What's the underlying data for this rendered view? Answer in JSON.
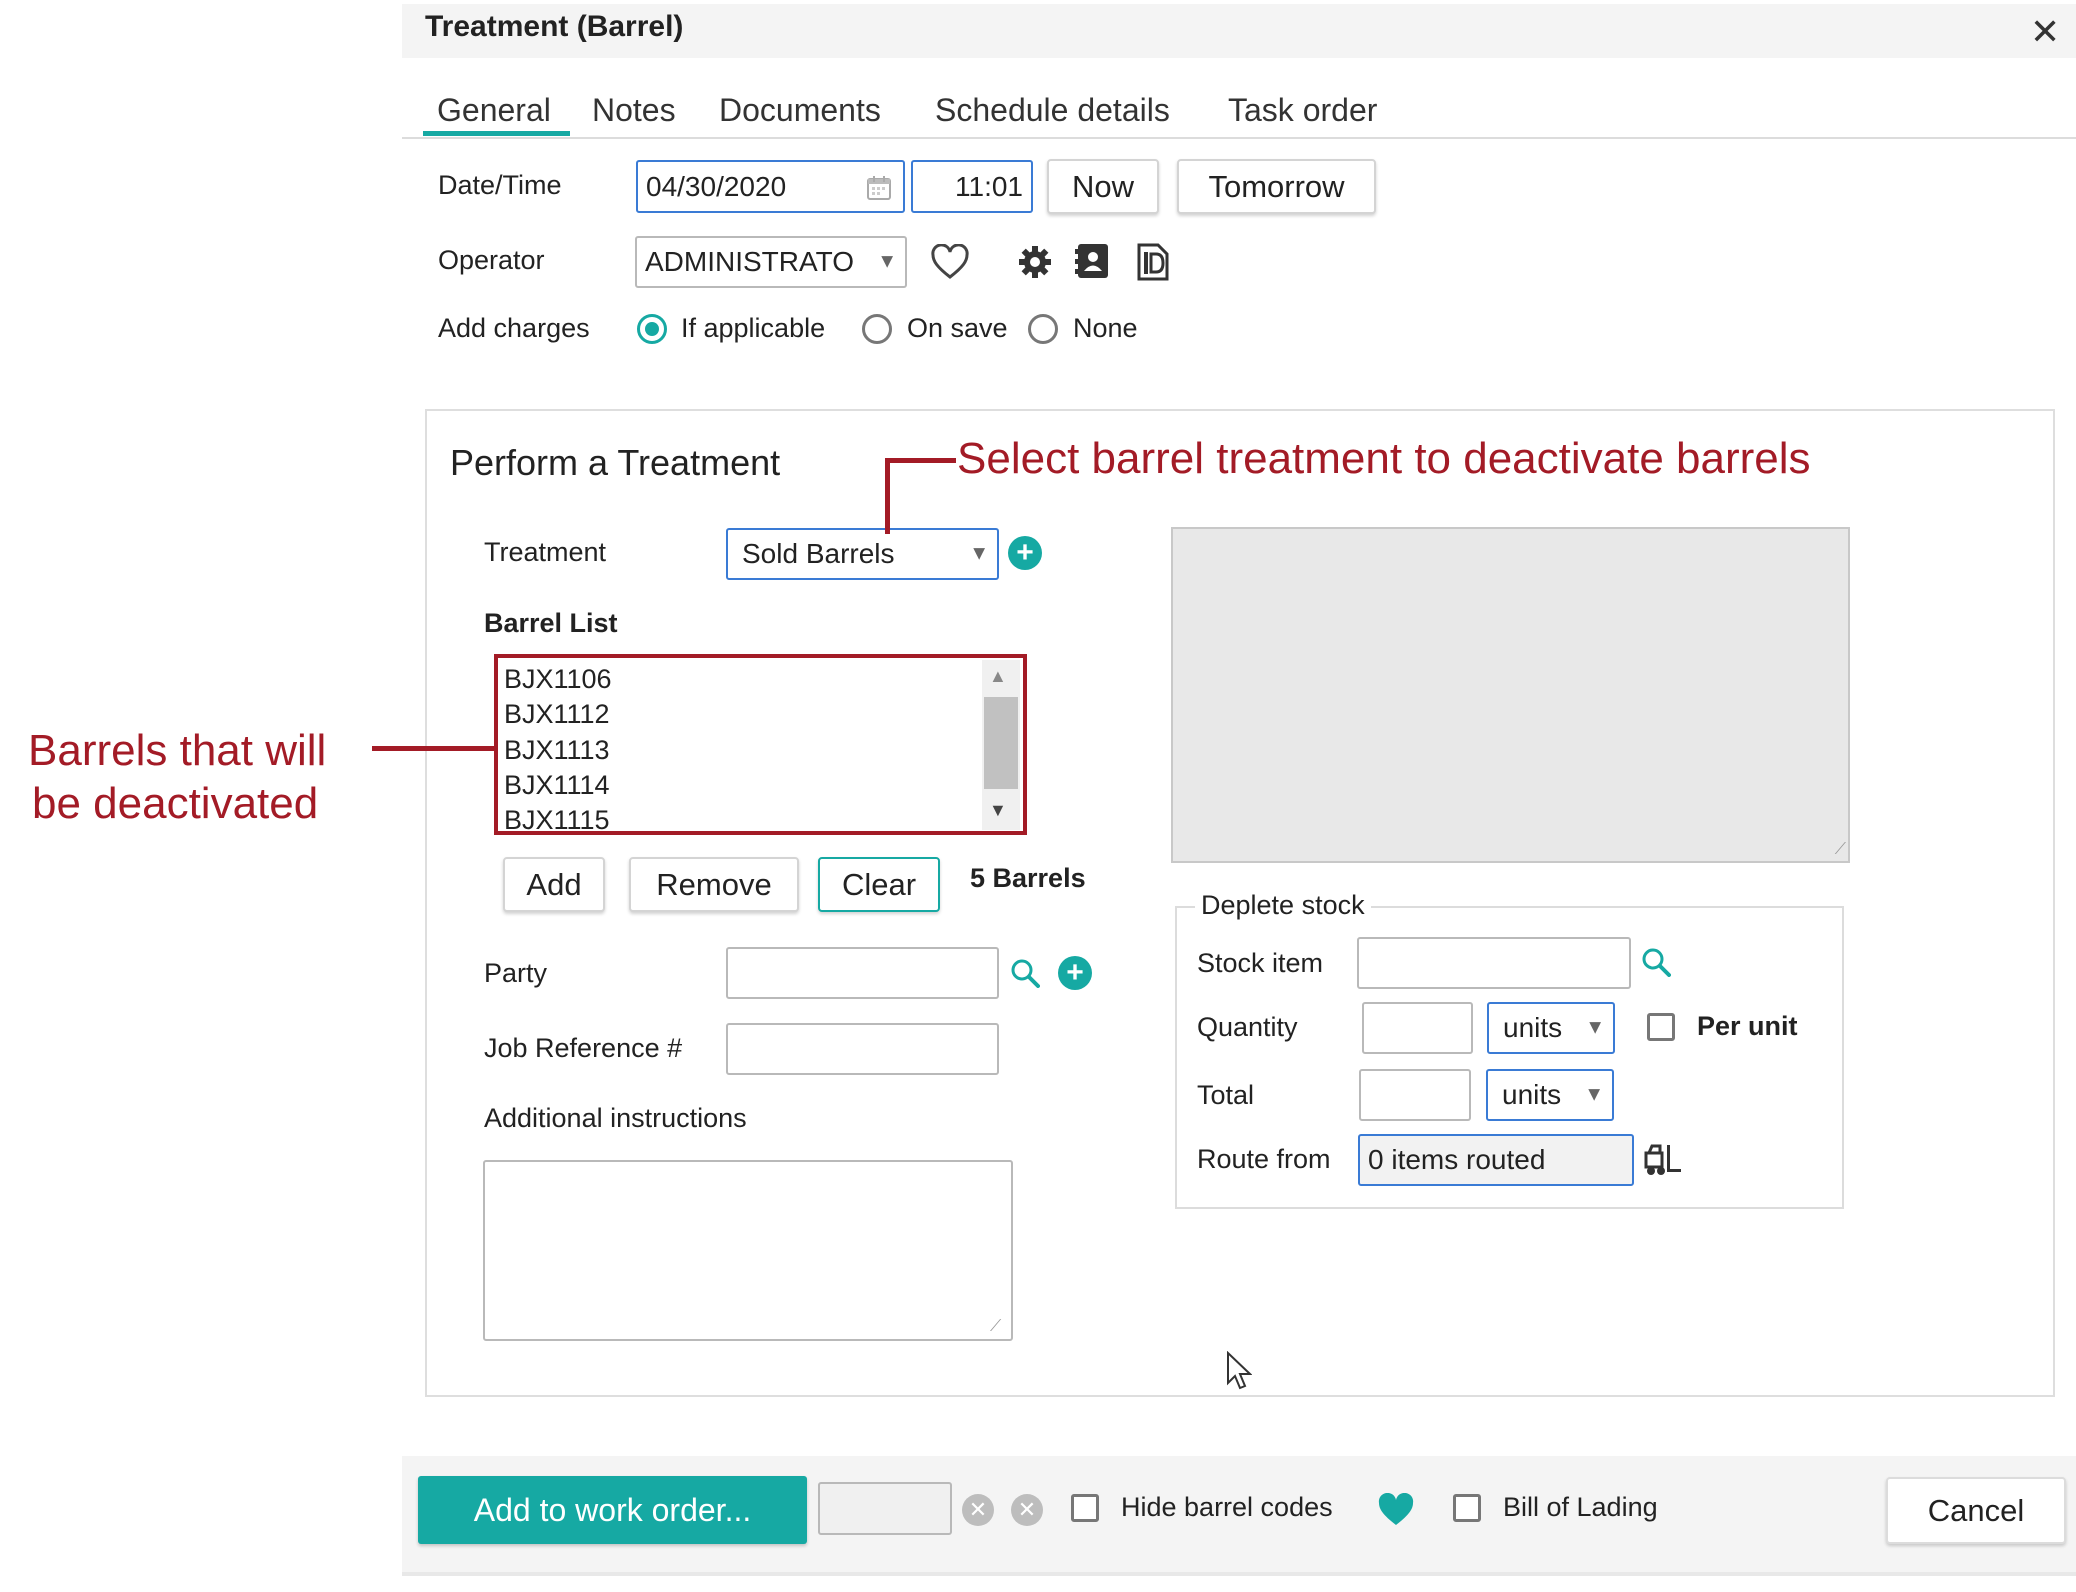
{
  "dialog": {
    "title": "Treatment (Barrel)"
  },
  "tabs": [
    {
      "label": "General"
    },
    {
      "label": "Notes"
    },
    {
      "label": "Documents"
    },
    {
      "label": "Schedule details"
    },
    {
      "label": "Task order"
    }
  ],
  "general": {
    "datetime_label": "Date/Time",
    "date_value": "04/30/2020",
    "time_value": "11:01",
    "now_label": "Now",
    "tomorrow_label": "Tomorrow",
    "operator_label": "Operator",
    "operator_value": "ADMINISTRATO",
    "add_charges_label": "Add charges",
    "add_charges_options": [
      "If applicable",
      "On save",
      "None"
    ],
    "add_charges_selected": "If applicable"
  },
  "treatment": {
    "section_title": "Perform a Treatment",
    "treatment_label": "Treatment",
    "treatment_value": "Sold Barrels",
    "barrel_list_label": "Barrel List",
    "barrels": [
      "BJX1106",
      "BJX1112",
      "BJX1113",
      "BJX1114",
      "BJX1115"
    ],
    "add_label": "Add",
    "remove_label": "Remove",
    "clear_label": "Clear",
    "barrel_count": "5 Barrels",
    "party_label": "Party",
    "party_value": "",
    "job_ref_label": "Job Reference #",
    "job_ref_value": "",
    "instructions_label": "Additional instructions",
    "instructions_value": ""
  },
  "deplete": {
    "legend": "Deplete stock",
    "stock_item_label": "Stock item",
    "stock_item_value": "",
    "quantity_label": "Quantity",
    "quantity_value": "",
    "quantity_unit": "units",
    "per_unit_label": "Per unit",
    "total_label": "Total",
    "total_value": "",
    "total_unit": "units",
    "route_from_label": "Route from",
    "route_from_value": "0 items routed"
  },
  "annotations": {
    "treatment_note": "Select barrel treatment to deactivate barrels",
    "barrels_note_line1": "Barrels that will",
    "barrels_note_line2": "be deactivated"
  },
  "footer": {
    "add_to_work_order_label": "Add to work order...",
    "work_order_value": "",
    "hide_barrel_codes_label": "Hide barrel codes",
    "bill_of_lading_label": "Bill of Lading",
    "cancel_label": "Cancel"
  },
  "colors": {
    "accent": "#16a9a3",
    "annotation": "#a31b26",
    "focus_border": "#3a7bd5"
  },
  "icons": {
    "date": "calendar-icon",
    "favorite": "heart-icon",
    "settings": "gear-icon",
    "contact": "contact-card-icon",
    "document": "document-icon",
    "add": "plus-circle-icon",
    "search": "search-icon",
    "forklift": "forklift-icon",
    "close": "close-icon",
    "clear": "clear-circle-icon"
  }
}
